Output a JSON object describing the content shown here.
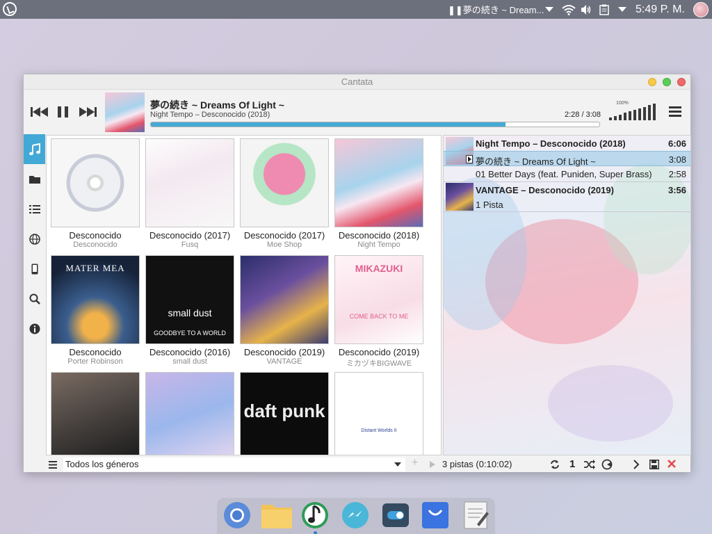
{
  "topbar": {
    "now_playing": "❚❚夢の続き ~ Dream...",
    "clock": "5:49 P. M."
  },
  "window": {
    "title": "Cantata"
  },
  "player": {
    "title": "夢の続き ~ Dreams Of Light ~",
    "subtitle": "Night Tempo – Desconocido (2018)",
    "time": "2:28 / 3:08",
    "progress": 0.79,
    "volume_label": "100%",
    "volume": 1.0
  },
  "sidebar": {
    "items": [
      {
        "name": "library",
        "icon": "music-note-icon",
        "active": true
      },
      {
        "name": "folders",
        "icon": "folder-icon",
        "active": false
      },
      {
        "name": "playlists",
        "icon": "list-icon",
        "active": false
      },
      {
        "name": "internet",
        "icon": "globe-icon",
        "active": false
      },
      {
        "name": "devices",
        "icon": "phone-icon",
        "active": false
      },
      {
        "name": "search",
        "icon": "search-icon",
        "active": false
      },
      {
        "name": "info",
        "icon": "info-icon",
        "active": false
      }
    ]
  },
  "albums": [
    {
      "title": "Desconocido",
      "artist": "Desconocido"
    },
    {
      "title": "Desconocido (2017)",
      "artist": "Fusq"
    },
    {
      "title": "Desconocido (2017)",
      "artist": "Moe Shop"
    },
    {
      "title": "Desconocido (2018)",
      "artist": "Night Tempo"
    },
    {
      "title": "Desconocido",
      "artist": "Porter Robinson",
      "art_text": "MATER MEA"
    },
    {
      "title": "Desconocido (2016)",
      "artist": "small dust",
      "art_text": "small dust",
      "art_text2": "GOODBYE TO A WORLD"
    },
    {
      "title": "Desconocido (2019)",
      "artist": "VANTAGE"
    },
    {
      "title": "Desconocido (2019)",
      "artist": "ミカヅキBIGWAVE",
      "art_text": "MIKAZUKI",
      "art_text2": "COME BACK TO ME"
    },
    {
      "title": "",
      "artist": ""
    },
    {
      "title": "",
      "artist": ""
    },
    {
      "title": "",
      "artist": "",
      "art_text": "daft punk"
    },
    {
      "title": "",
      "artist": "",
      "art_text": "Distant Worlds II"
    }
  ],
  "playlist": {
    "groups": [
      {
        "header": "Night Tempo – Desconocido (2018)",
        "duration": "6:06",
        "tracks": [
          {
            "title": "夢の続き ~ Dreams Of Light ~",
            "duration": "3:08",
            "playing": true
          },
          {
            "title": "01 Better Days (feat. Puniden, Super Brass)",
            "duration": "2:58",
            "playing": false
          }
        ]
      },
      {
        "header": "VANTAGE – Desconocido (2019)",
        "duration": "3:56",
        "tracks": [
          {
            "title": "1 Pista",
            "duration": "",
            "playing": false
          }
        ]
      }
    ]
  },
  "bottombar": {
    "genre": "Todos los géneros",
    "summary": "3 pistas (0:10:02)",
    "repeat_count": "1"
  },
  "colors": {
    "accent": "#42a9d6",
    "progress": "#43aad3",
    "topbar": "#6c6f7c",
    "close": "#e2474b"
  },
  "dock": {
    "apps": [
      "chromium-icon",
      "folder-icon",
      "music-player-icon",
      "messenger-icon",
      "settings-toggle-icon",
      "store-bag-icon",
      "notepad-icon"
    ]
  }
}
